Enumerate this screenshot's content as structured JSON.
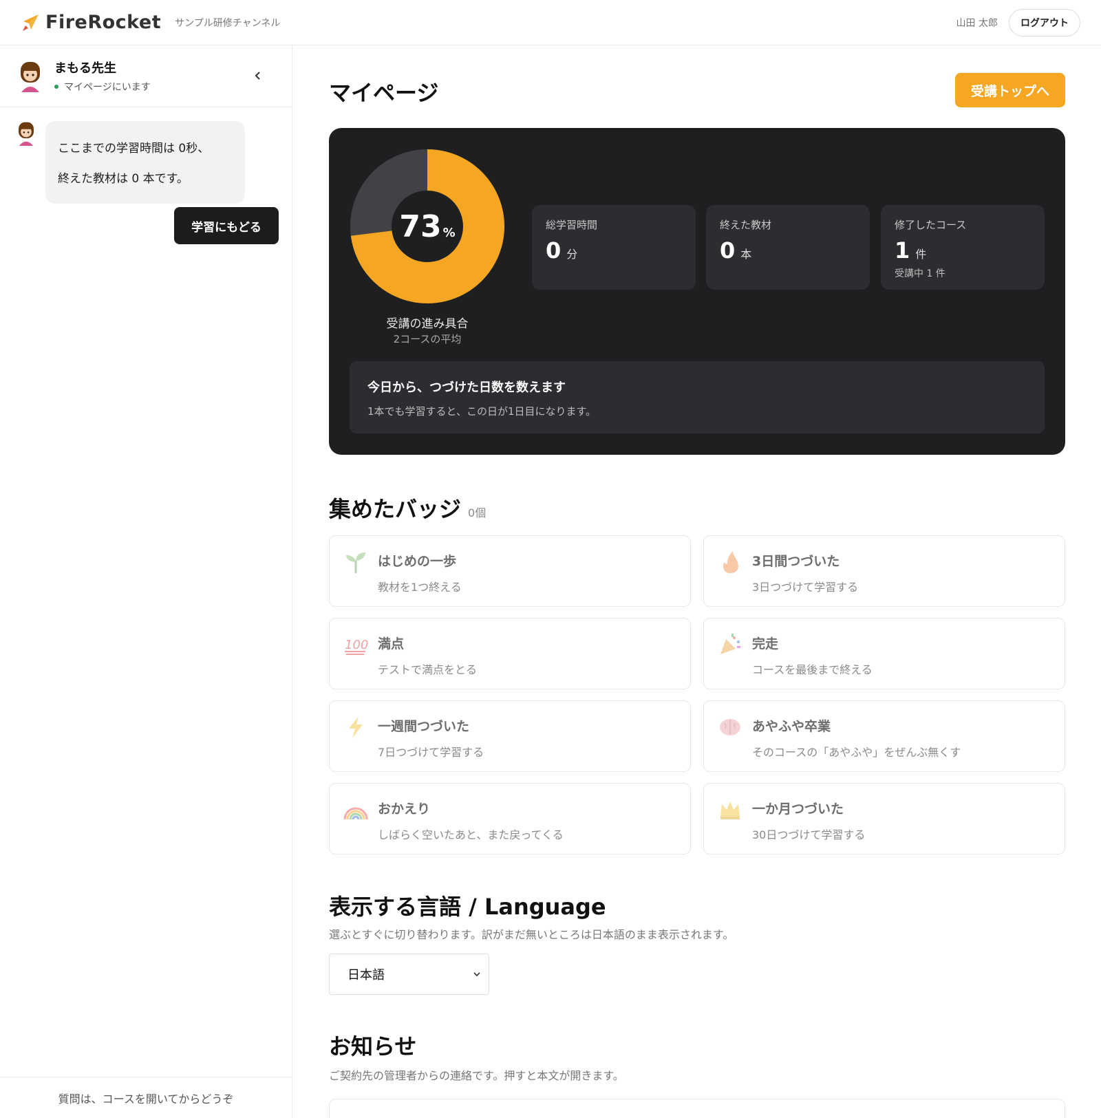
{
  "header": {
    "brand": "FireRocket",
    "channel": "サンプル研修チャンネル",
    "user_name": "山田 太郎",
    "logout_label": "ログアウト"
  },
  "sidebar": {
    "teacher_name": "まもる先生",
    "status": "マイページにいます",
    "message_line1": "ここまでの学習時間は 0秒、",
    "message_line2": "終えた教材は 0 本です。",
    "back_button": "学習にもどる",
    "footer": "質問は、コースを開いてからどうぞ"
  },
  "main": {
    "title": "マイページ",
    "top_button": "受講トップへ",
    "progress": {
      "percent": 73,
      "percent_text": "73",
      "percent_unit": "%",
      "label": "受講の進み具合",
      "sub": "2コースの平均"
    },
    "stats": [
      {
        "label": "総学習時間",
        "value": "0",
        "unit": "分",
        "note": ""
      },
      {
        "label": "終えた教材",
        "value": "0",
        "unit": "本",
        "note": ""
      },
      {
        "label": "修了したコース",
        "value": "1",
        "unit": "件",
        "note": "受講中 1 件"
      }
    ],
    "streak": {
      "title": "今日から、つづけた日数を数えます",
      "desc": "1本でも学習すると、この日が1日目になります。"
    },
    "badges_title": "集めたバッジ",
    "badges_count": "0個",
    "badges": [
      {
        "icon": "seedling-icon",
        "name": "はじめの一歩",
        "desc": "教材を1つ終える"
      },
      {
        "icon": "fire-icon",
        "name": "3日間つづいた",
        "desc": "3日つづけて学習する"
      },
      {
        "icon": "hundred-points-icon",
        "name": "満点",
        "desc": "テストで満点をとる"
      },
      {
        "icon": "party-popper-icon",
        "name": "完走",
        "desc": "コースを最後まで終える"
      },
      {
        "icon": "lightning-icon",
        "name": "一週間つづいた",
        "desc": "7日つづけて学習する"
      },
      {
        "icon": "brain-icon",
        "name": "あやふや卒業",
        "desc": "そのコースの「あやふや」をぜんぶ無くす"
      },
      {
        "icon": "rainbow-icon",
        "name": "おかえり",
        "desc": "しばらく空いたあと、また戻ってくる"
      },
      {
        "icon": "crown-icon",
        "name": "一か月つづいた",
        "desc": "30日つづけて学習する"
      }
    ],
    "language": {
      "title": "表示する言語 / Language",
      "desc": "選ぶとすぐに切り替わります。訳がまだ無いところは日本語のまま表示されます。",
      "selected": "日本語"
    },
    "notices": {
      "title": "お知らせ",
      "desc": "ご契約先の管理者からの連絡です。押すと本文が開きます。"
    }
  },
  "colors": {
    "accent": "#f5a623",
    "panel": "#1e1f21",
    "card": "#2c2d30",
    "status_online": "#2f9e5b"
  }
}
